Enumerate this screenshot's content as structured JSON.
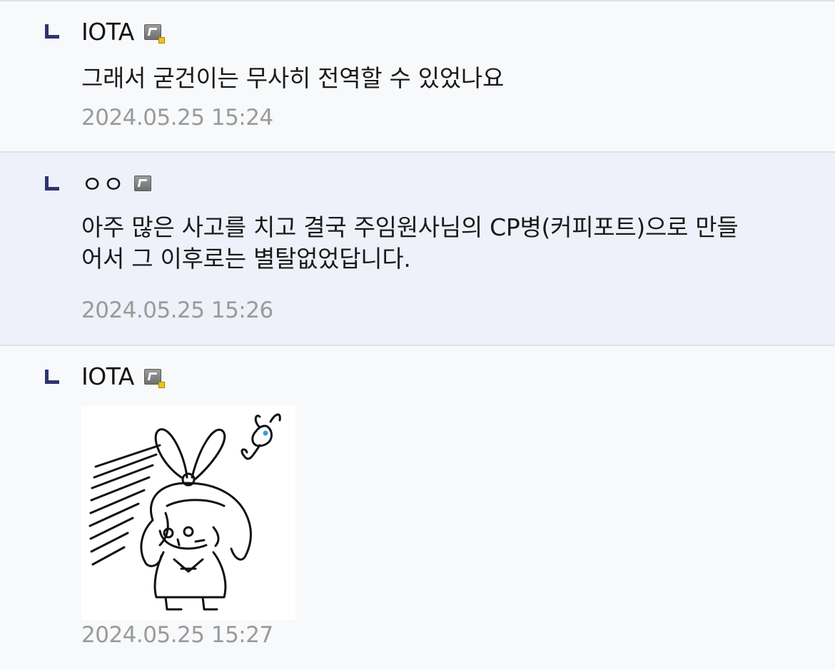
{
  "replies": [
    {
      "author": "IOTA",
      "badge_icon": "sticker-badge-icon",
      "message": "그래서 굳건이는 무사히 전역할 수 있었나요",
      "timestamp": "2024.05.25 15:24"
    },
    {
      "author": "ㅇㅇ",
      "badge_icon": "sticker-badge-icon",
      "message": "아주 많은 사고를 치고 결국 주임원사님의 CP병(커피포트)으로 만들\n어서 그 이후로는 별탈없었답니다.",
      "timestamp": "2024.05.25 15:26"
    },
    {
      "author": "IOTA",
      "badge_icon": "sticker-badge-icon",
      "sticker": "line-drawing-girl-bunny-ears-sticker",
      "timestamp": "2024.05.25 15:27"
    }
  ],
  "colors": {
    "reply_arrow": "#2e3470",
    "highlight_bg": "#eef1fa",
    "timestamp": "#9a9a9a"
  }
}
